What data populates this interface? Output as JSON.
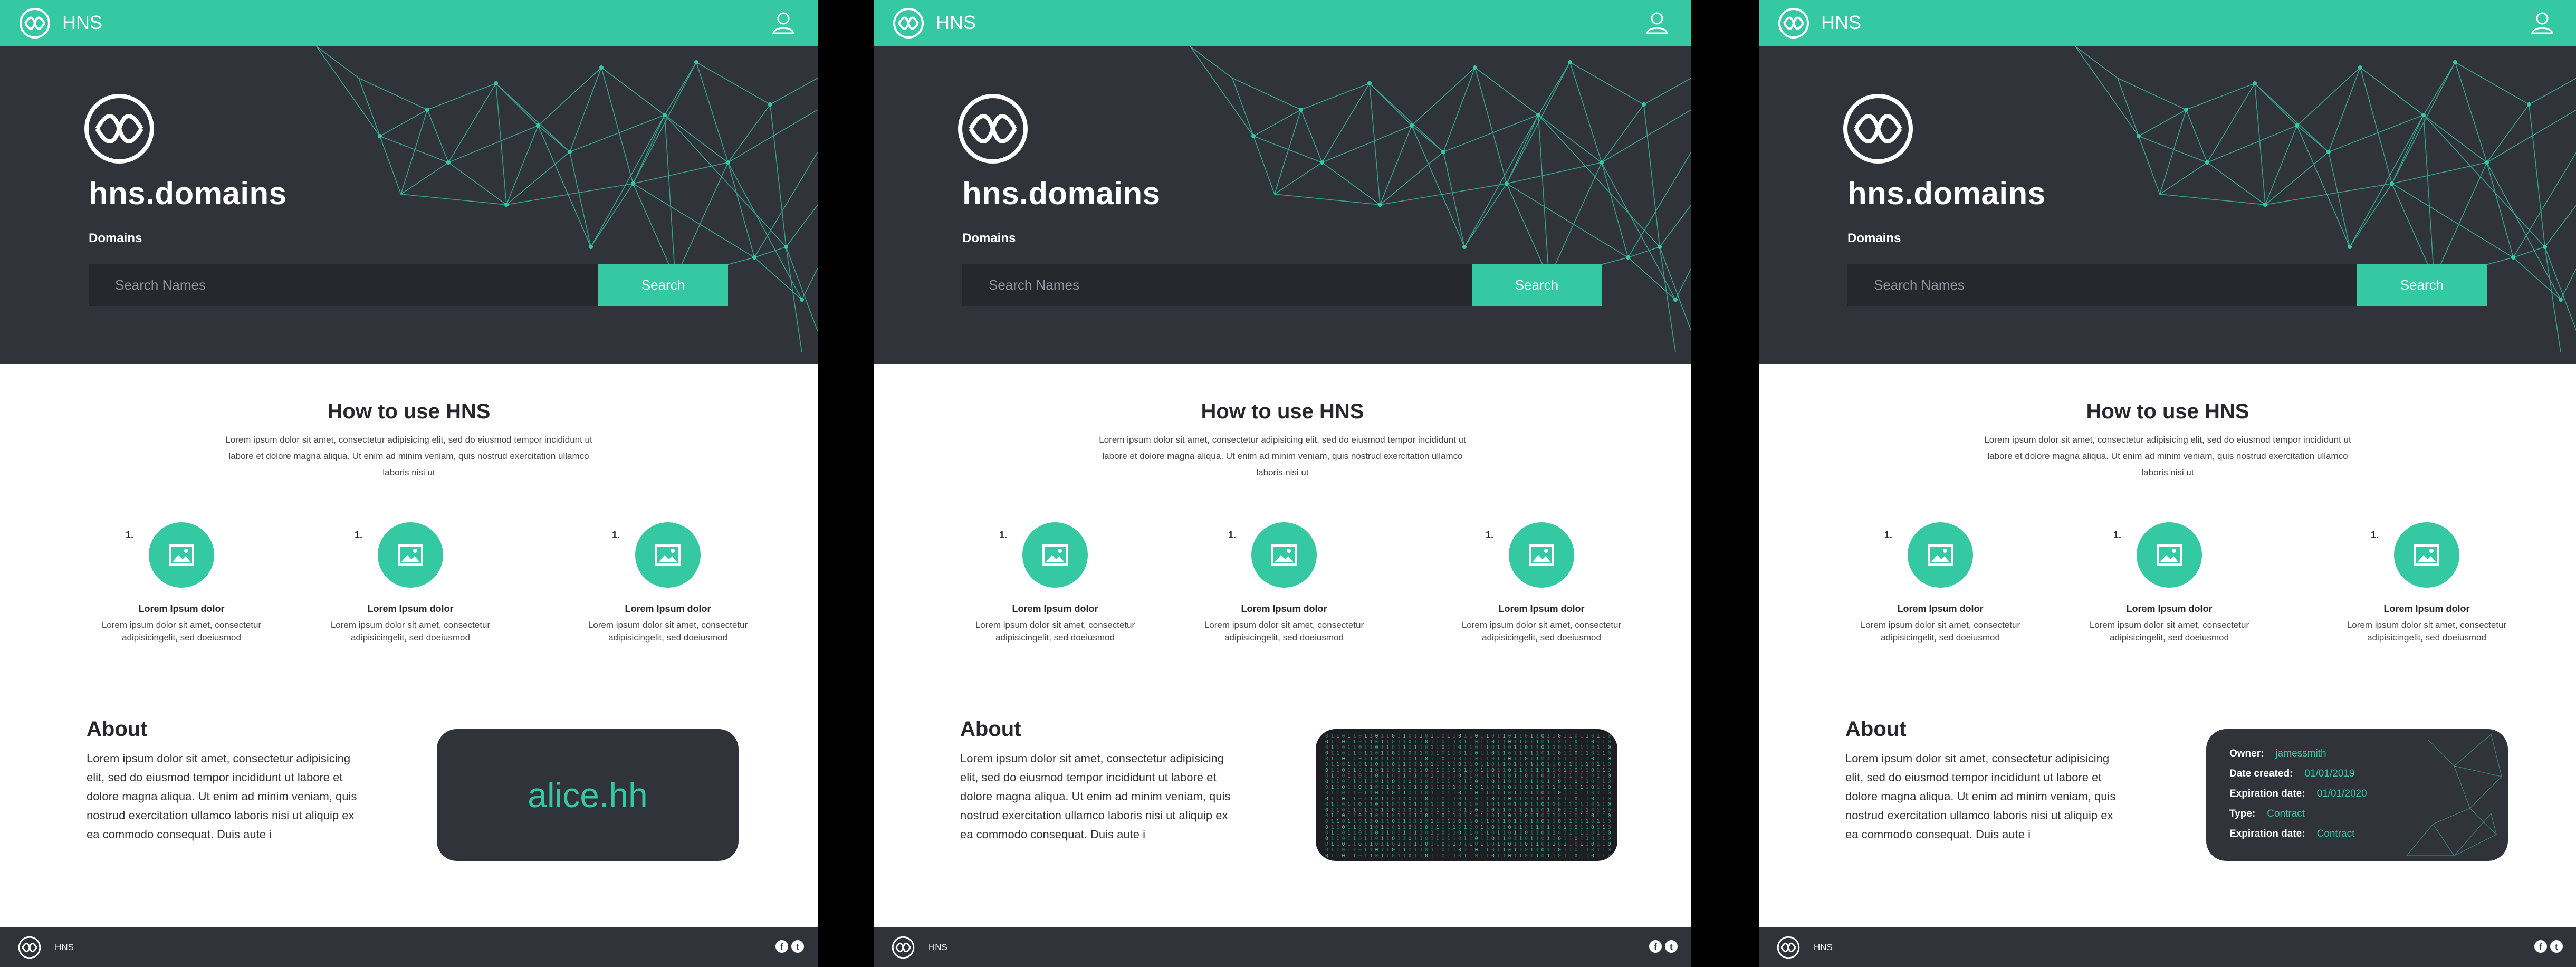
{
  "brand": "HNS",
  "hero": {
    "title": "hns.domains",
    "subtitle": "Domains",
    "search_placeholder": "Search Names",
    "search_button": "Search"
  },
  "how": {
    "title": "How to use HNS",
    "text": "Lorem ipsum dolor sit amet, consectetur adipisicing elit, sed do eiusmod tempor incididunt ut labore et dolore magna aliqua. Ut enim ad minim veniam, quis nostrud exercitation ullamco laboris nisi ut",
    "steps": [
      {
        "num": "1.",
        "title": "Lorem Ipsum dolor",
        "text": "Lorem ipsum dolor sit amet, consectetur adipisicingelit, sed doeiusmod"
      },
      {
        "num": "1.",
        "title": "Lorem Ipsum dolor",
        "text": "Lorem ipsum dolor sit amet, consectetur adipisicingelit, sed doeiusmod"
      },
      {
        "num": "1.",
        "title": "Lorem Ipsum dolor",
        "text": "Lorem ipsum dolor sit amet, consectetur adipisicingelit, sed doeiusmod"
      }
    ]
  },
  "about": {
    "title": "About",
    "text": "Lorem ipsum dolor sit amet, consectetur adipisicing elit, sed do eiusmod tempor incididunt ut labore et dolore magna aliqua. Ut enim ad minim veniam, quis nostrud exercitation ullamco laboris nisi ut aliquip ex ea commodo consequat. Duis aute i"
  },
  "cards": {
    "alice": "alice.hh",
    "details": [
      {
        "label": "Owner:",
        "value": "jamessmith"
      },
      {
        "label": "Date created:",
        "value": "01/01/2019"
      },
      {
        "label": "Expiration date:",
        "value": "01/01/2020"
      },
      {
        "label": "Type:",
        "value": "Contract"
      },
      {
        "label": "Expiration date:",
        "value": "Contract"
      }
    ]
  },
  "footer": {
    "brand": "HNS",
    "facebook": "f",
    "twitter": "t"
  },
  "colors": {
    "accent": "#35c9a3",
    "dark": "#31333b",
    "darker": "#26282e"
  },
  "icons": [
    "hns-logo-icon",
    "user-icon",
    "image-icon",
    "facebook-icon",
    "twitter-icon"
  ]
}
